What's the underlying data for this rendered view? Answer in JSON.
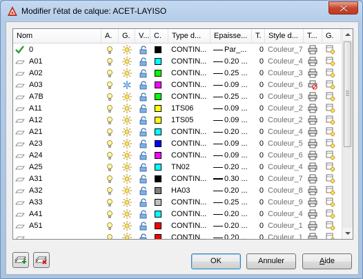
{
  "window": {
    "title": "Modifier l'état de calque: ACET-LAYISO"
  },
  "columns": [
    "Nom",
    "A.",
    "G.",
    "V...",
    "C.",
    "Type d...",
    "Epaisse...",
    "T.",
    "Style d...",
    "T...",
    "G."
  ],
  "layers": [
    {
      "name": "0",
      "current": true,
      "frozen": false,
      "color": "#000000",
      "linetype": "CONTIN...",
      "lineweight": "Par_...",
      "lw_thick": false,
      "trans": "0",
      "style": "Couleur_7",
      "plot_off": false
    },
    {
      "name": "A01",
      "current": false,
      "frozen": false,
      "color": "#00ffff",
      "linetype": "CONTIN...",
      "lineweight": "0.20 ...",
      "lw_thick": false,
      "trans": "0",
      "style": "Couleur_4",
      "plot_off": false
    },
    {
      "name": "A02",
      "current": false,
      "frozen": false,
      "color": "#00ff00",
      "linetype": "CONTIN...",
      "lineweight": "0.25 ...",
      "lw_thick": false,
      "trans": "0",
      "style": "Couleur_3",
      "plot_off": false
    },
    {
      "name": "A03",
      "current": false,
      "frozen": true,
      "color": "#ff00ff",
      "linetype": "CONTIN...",
      "lineweight": "0.09 ...",
      "lw_thick": false,
      "trans": "0",
      "style": "Couleur_6",
      "plot_off": true
    },
    {
      "name": "A7B",
      "current": false,
      "frozen": false,
      "color": "#00ff00",
      "linetype": "CONTIN...",
      "lineweight": "0.25 ...",
      "lw_thick": false,
      "trans": "0",
      "style": "Couleur_3",
      "plot_off": false
    },
    {
      "name": "A11",
      "current": false,
      "frozen": false,
      "color": "#ffff00",
      "linetype": "1TS06",
      "lineweight": "0.09 ...",
      "lw_thick": false,
      "trans": "0",
      "style": "Couleur_2",
      "plot_off": false
    },
    {
      "name": "A12",
      "current": false,
      "frozen": false,
      "color": "#ffff00",
      "linetype": "1TS05",
      "lineweight": "0.09 ...",
      "lw_thick": false,
      "trans": "0",
      "style": "Couleur_2",
      "plot_off": false
    },
    {
      "name": "A21",
      "current": false,
      "frozen": false,
      "color": "#00ffff",
      "linetype": "CONTIN...",
      "lineweight": "0.20 ...",
      "lw_thick": false,
      "trans": "0",
      "style": "Couleur_4",
      "plot_off": false
    },
    {
      "name": "A23",
      "current": false,
      "frozen": false,
      "color": "#0000ff",
      "linetype": "CONTIN...",
      "lineweight": "0.09 ...",
      "lw_thick": false,
      "trans": "0",
      "style": "Couleur_5",
      "plot_off": false
    },
    {
      "name": "A24",
      "current": false,
      "frozen": false,
      "color": "#ff00ff",
      "linetype": "CONTIN...",
      "lineweight": "0.09 ...",
      "lw_thick": false,
      "trans": "0",
      "style": "Couleur_6",
      "plot_off": false
    },
    {
      "name": "A25",
      "current": false,
      "frozen": false,
      "color": "#00ffff",
      "linetype": "TN02",
      "lineweight": "0.20 ...",
      "lw_thick": false,
      "trans": "0",
      "style": "Couleur_4",
      "plot_off": false
    },
    {
      "name": "A31",
      "current": false,
      "frozen": false,
      "color": "#000000",
      "linetype": "CONTIN...",
      "lineweight": "0.30 ...",
      "lw_thick": true,
      "trans": "0",
      "style": "Couleur_7",
      "plot_off": false
    },
    {
      "name": "A32",
      "current": false,
      "frozen": false,
      "color": "#808080",
      "linetype": "HA03",
      "lineweight": "0.20 ...",
      "lw_thick": false,
      "trans": "0",
      "style": "Couleur_8",
      "plot_off": false
    },
    {
      "name": "A33",
      "current": false,
      "frozen": false,
      "color": "#c0c0c0",
      "linetype": "CONTIN...",
      "lineweight": "0.25 ...",
      "lw_thick": false,
      "trans": "0",
      "style": "Couleur_9",
      "plot_off": false
    },
    {
      "name": "A41",
      "current": false,
      "frozen": false,
      "color": "#00ffff",
      "linetype": "CONTIN...",
      "lineweight": "0.20 ...",
      "lw_thick": false,
      "trans": "0",
      "style": "Couleur_4",
      "plot_off": false
    },
    {
      "name": "A51",
      "current": false,
      "frozen": false,
      "color": "#ff0000",
      "linetype": "CONTIN...",
      "lineweight": "0.20 ...",
      "lw_thick": false,
      "trans": "0",
      "style": "Couleur_1",
      "plot_off": false
    },
    {
      "name": "",
      "current": false,
      "frozen": false,
      "color": "#ff0000",
      "linetype": "CONTIN...",
      "lineweight": "0.20 ...",
      "lw_thick": false,
      "trans": "0",
      "style": "Couleur_1",
      "plot_off": false
    }
  ],
  "buttons": {
    "ok": "OK",
    "cancel": "Annuler",
    "help_prefix": "",
    "help_mnemonic": "A",
    "help_rest": "ide"
  },
  "icons": {
    "new_state": "new-layer-state-icon",
    "delete_state": "delete-layer-state-icon"
  }
}
